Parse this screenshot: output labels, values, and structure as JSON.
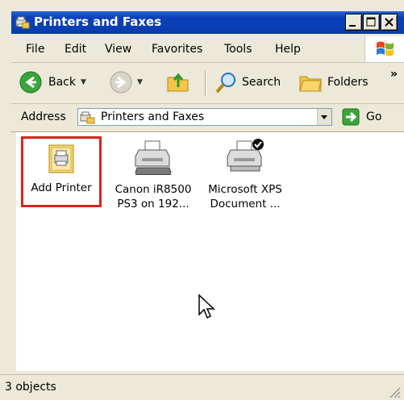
{
  "window": {
    "title": "Printers and Faxes"
  },
  "title_buttons": {
    "minimize": "_",
    "maximize": "□",
    "close": "X"
  },
  "menu": [
    "File",
    "Edit",
    "View",
    "Favorites",
    "Tools",
    "Help"
  ],
  "toolbar": {
    "back_label": "Back",
    "search_label": "Search",
    "folders_label": "Folders",
    "more": "»"
  },
  "address": {
    "label": "Address",
    "value": "Printers and Faxes",
    "go_label": "Go"
  },
  "items": [
    {
      "label": "Add Printer",
      "icon": "add-printer-icon",
      "selected": true
    },
    {
      "label": "Canon iR8500\nPS3 on 192...",
      "icon": "network-printer-icon"
    },
    {
      "label": "Microsoft XPS\nDocument ...",
      "icon": "default-printer-icon"
    }
  ],
  "status": {
    "text": "3 objects"
  },
  "colors": {
    "title_bar": "#0a3fb8",
    "highlight": "#d9231d",
    "chrome": "#ece9d8"
  }
}
